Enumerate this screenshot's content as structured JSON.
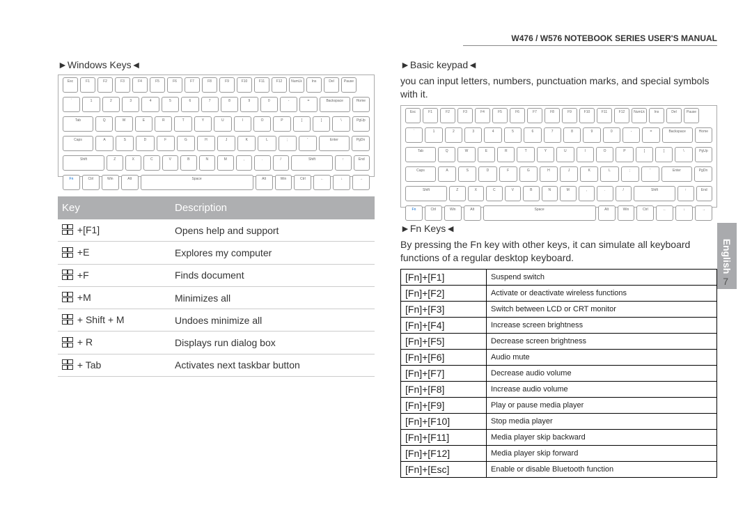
{
  "header": "W476 / W576 NOTEBOOK SERIES USER'S MANUAL",
  "pageNumber": "7",
  "sideTab": "English",
  "left": {
    "title": "►Windows Keys◄",
    "table": {
      "head": {
        "k": "Key",
        "d": "Description"
      },
      "rows": [
        {
          "k": "+[F1]",
          "d": "Opens help and support"
        },
        {
          "k": "+E",
          "d": "Explores my computer"
        },
        {
          "k": "+F",
          "d": "Finds document"
        },
        {
          "k": "+M",
          "d": "Minimizes all"
        },
        {
          "k": "+ Shift + M",
          "d": "Undoes minimize all"
        },
        {
          "k": "+ R",
          "d": "Displays run dialog box"
        },
        {
          "k": "+ Tab",
          "d": "Activates next taskbar button"
        }
      ]
    }
  },
  "right": {
    "basic": {
      "title": "►Basic keypad◄",
      "desc": "you can input letters, numbers, punctuation marks, and special symbols with it."
    },
    "fn": {
      "title": "►Fn Keys◄",
      "desc": "By pressing the Fn key with other keys, it can simulate all keyboard functions of a regular desktop keyboard.",
      "rows": [
        {
          "k": "[Fn]+[F1]",
          "d": "Suspend switch"
        },
        {
          "k": "[Fn]+[F2]",
          "d": "Activate or deactivate wireless functions"
        },
        {
          "k": "[Fn]+[F3]",
          "d": "Switch between LCD or CRT monitor"
        },
        {
          "k": "[Fn]+[F4]",
          "d": "Increase screen brightness"
        },
        {
          "k": "[Fn]+[F5]",
          "d": "Decrease screen brightness"
        },
        {
          "k": "[Fn]+[F6]",
          "d": "Audio mute"
        },
        {
          "k": "[Fn]+[F7]",
          "d": "Decrease audio volume"
        },
        {
          "k": "[Fn]+[F8]",
          "d": "Increase audio volume"
        },
        {
          "k": "[Fn]+[F9]",
          "d": "Play or pause media player"
        },
        {
          "k": "[Fn]+[F10]",
          "d": "Stop media player"
        },
        {
          "k": "[Fn]+[F11]",
          "d": "Media player skip backward"
        },
        {
          "k": "[Fn]+[F12]",
          "d": "Media player skip forward"
        },
        {
          "k": "[Fn]+[Esc]",
          "d": "Enable or disable Bluetooth function"
        }
      ]
    }
  },
  "kb": {
    "r1": [
      "Esc",
      "F1",
      "F2",
      "F3",
      "F4",
      "F5",
      "F6",
      "F7",
      "F8",
      "F9",
      "F10",
      "F11",
      "F12",
      "NumLk",
      "Ins",
      "Del",
      "Pause"
    ],
    "r2": [
      "`",
      "1",
      "2",
      "3",
      "4",
      "5",
      "6",
      "7",
      "8",
      "9",
      "0",
      "-",
      "=",
      "Backspace",
      "Home"
    ],
    "r3": [
      "Tab",
      "Q",
      "W",
      "E",
      "R",
      "T",
      "Y",
      "U",
      "I",
      "O",
      "P",
      "[",
      "]",
      "\\",
      "PgUp"
    ],
    "r4": [
      "Caps",
      "A",
      "S",
      "D",
      "F",
      "G",
      "H",
      "J",
      "K",
      "L",
      ";",
      "'",
      "Enter",
      "PgDn"
    ],
    "r5": [
      "Shift",
      "Z",
      "X",
      "C",
      "V",
      "B",
      "N",
      "M",
      ",",
      ".",
      "/",
      "Shift",
      "↑",
      "End"
    ],
    "r6": [
      "Fn",
      "Ctrl",
      "Win",
      "Alt",
      "Space",
      "Alt",
      "Win",
      "Ctrl",
      "←",
      "↓",
      "→"
    ]
  }
}
